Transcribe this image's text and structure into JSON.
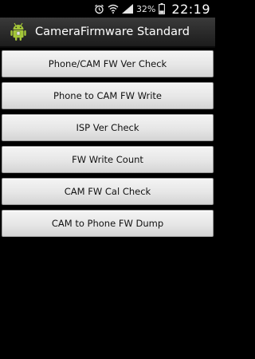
{
  "status_bar": {
    "battery_percent": "32%",
    "time": "22:19"
  },
  "app": {
    "title": "CameraFirmware Standard",
    "icon": "android-robot-icon"
  },
  "buttons": [
    {
      "label": "Phone/CAM FW Ver Check"
    },
    {
      "label": "Phone to CAM FW Write"
    },
    {
      "label": "ISP Ver Check"
    },
    {
      "label": "FW Write Count"
    },
    {
      "label": "CAM FW Cal Check"
    },
    {
      "label": "CAM to Phone FW Dump"
    }
  ],
  "colors": {
    "background": "#000000",
    "button_face": "#e6e6e6",
    "android_green": "#a4c639"
  }
}
